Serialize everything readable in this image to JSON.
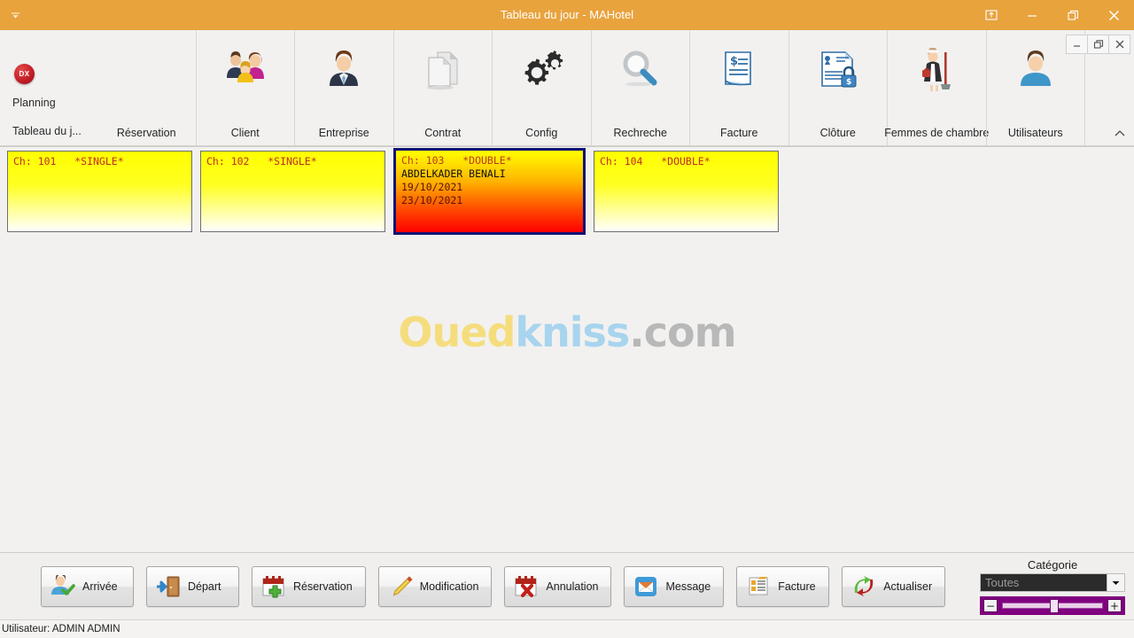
{
  "window": {
    "title": "Tableau du jour - MAHotel",
    "quick_access_icon": "chevron-down-icon",
    "controls": [
      {
        "name": "ribbon-display-options",
        "icon": "ribbon-options-icon"
      },
      {
        "name": "minimize",
        "icon": "minimize-icon"
      },
      {
        "name": "restore",
        "icon": "restore-icon"
      },
      {
        "name": "close",
        "icon": "close-icon"
      }
    ],
    "accent_color": "#e8a33d"
  },
  "ribbon": {
    "logo": "DX",
    "nav": [
      {
        "label": "Planning"
      },
      {
        "label": "Tableau du j..."
      }
    ],
    "groups": [
      {
        "label": "Réservation",
        "icon": "calendar-icon"
      },
      {
        "label": "Client",
        "icon": "clients-group-icon"
      },
      {
        "label": "Entreprise",
        "icon": "businessman-icon"
      },
      {
        "label": "Contrat",
        "icon": "documents-icon"
      },
      {
        "label": "Config",
        "icon": "gears-icon"
      },
      {
        "label": "Rechreche",
        "icon": "magnifier-icon"
      },
      {
        "label": "Facture",
        "icon": "invoice-icon"
      },
      {
        "label": "Clôture",
        "icon": "lock-document-icon"
      },
      {
        "label": "Femmes de chambre",
        "icon": "housekeeper-icon"
      },
      {
        "label": "Utilisateurs",
        "icon": "user-icon"
      }
    ],
    "collapse_icon": "chevron-up-icon"
  },
  "mdi_controls": [
    {
      "name": "mdi-minimize",
      "icon": "minimize-icon"
    },
    {
      "name": "mdi-restore",
      "icon": "restore-icon"
    },
    {
      "name": "mdi-close",
      "icon": "close-icon"
    }
  ],
  "rooms": [
    {
      "header": "Ch: 101   *SINGLE*",
      "guest": "",
      "date_in": "",
      "date_out": "",
      "state": "free",
      "selected": false
    },
    {
      "header": "Ch: 102   *SINGLE*",
      "guest": "",
      "date_in": "",
      "date_out": "",
      "state": "free",
      "selected": false
    },
    {
      "header": "Ch: 103   *DOUBLE*",
      "guest": "ABDELKADER BENALI",
      "date_in": "19/10/2021",
      "date_out": "23/10/2021",
      "state": "occupied",
      "selected": true
    },
    {
      "header": "Ch: 104   *DOUBLE*",
      "guest": "",
      "date_in": "",
      "date_out": "",
      "state": "free",
      "selected": false
    }
  ],
  "watermark": {
    "part1": "Oued",
    "part2": "kniss",
    "part3": ".com",
    "color1": "#f5dd7e",
    "color2": "#a8d4ee",
    "color3": "#b8b8b8"
  },
  "actions": [
    {
      "label": "Arrivée",
      "icon": "arrival-icon"
    },
    {
      "label": "Départ",
      "icon": "departure-icon"
    },
    {
      "label": "Réservation",
      "icon": "calendar-add-icon"
    },
    {
      "label": "Modification",
      "icon": "pencil-icon"
    },
    {
      "label": "Annulation",
      "icon": "calendar-delete-icon"
    },
    {
      "label": "Message",
      "icon": "mail-icon"
    },
    {
      "label": "Facture",
      "icon": "invoice-list-icon"
    },
    {
      "label": "Actualiser",
      "icon": "refresh-icon"
    }
  ],
  "category": {
    "label": "Catégorie",
    "selected": "Toutes",
    "arrow_icon": "chevron-down-icon",
    "zoom_minus": "−",
    "zoom_plus": "+",
    "accent": "#800080"
  },
  "statusbar": {
    "text": "Utilisateur: ADMIN ADMIN"
  }
}
